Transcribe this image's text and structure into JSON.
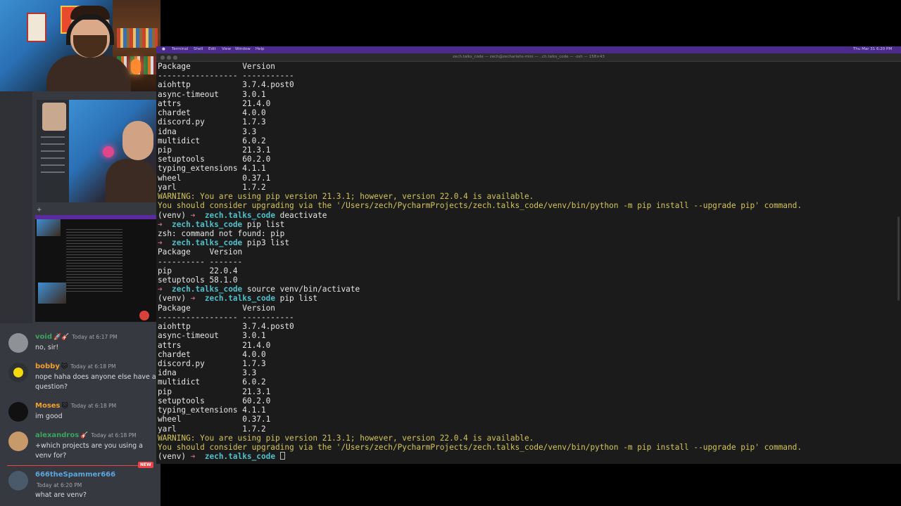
{
  "terminal": {
    "menu": [
      "Terminal",
      "Shell",
      "Edit",
      "View",
      "Window",
      "Help"
    ],
    "window_title": "zech.talks_code — zech@zecharlahs-mini — ..ch.talks_code — -zsh — 158×43",
    "clock": "Thu Mar 31  6:20 PM",
    "prompt_venv": "(venv)",
    "prompt_arrow": "➜",
    "prompt_dir": "zech.talks_code",
    "lines": [
      {
        "kind": "out",
        "text": "Package           Version"
      },
      {
        "kind": "out",
        "text": "----------------- -----------"
      },
      {
        "kind": "out",
        "text": "aiohttp           3.7.4.post0"
      },
      {
        "kind": "out",
        "text": "async-timeout     3.0.1"
      },
      {
        "kind": "out",
        "text": "attrs             21.4.0"
      },
      {
        "kind": "out",
        "text": "chardet           4.0.0"
      },
      {
        "kind": "out",
        "text": "discord.py        1.7.3"
      },
      {
        "kind": "out",
        "text": "idna              3.3"
      },
      {
        "kind": "out",
        "text": "multidict         6.0.2"
      },
      {
        "kind": "out",
        "text": "pip               21.3.1"
      },
      {
        "kind": "out",
        "text": "setuptools        60.2.0"
      },
      {
        "kind": "out",
        "text": "typing_extensions 4.1.1"
      },
      {
        "kind": "out",
        "text": "wheel             0.37.1"
      },
      {
        "kind": "out",
        "text": "yarl              1.7.2"
      },
      {
        "kind": "warn",
        "text": "WARNING: You are using pip version 21.3.1; however, version 22.0.4 is available."
      },
      {
        "kind": "warn",
        "text": "You should consider upgrading via the '/Users/zech/PycharmProjects/zech.talks_code/venv/bin/python -m pip install --upgrade pip' command."
      },
      {
        "kind": "venv",
        "text": " deactivate"
      },
      {
        "kind": "plain",
        "text": " pip list"
      },
      {
        "kind": "out",
        "text": "zsh: command not found: pip"
      },
      {
        "kind": "plain",
        "text": " pip3 list"
      },
      {
        "kind": "out",
        "text": "Package    Version"
      },
      {
        "kind": "out",
        "text": "---------- -------"
      },
      {
        "kind": "out",
        "text": "pip        22.0.4"
      },
      {
        "kind": "out",
        "text": "setuptools 58.1.0"
      },
      {
        "kind": "plain",
        "text": " source venv/bin/activate"
      },
      {
        "kind": "venv",
        "text": " pip list"
      },
      {
        "kind": "out",
        "text": "Package           Version"
      },
      {
        "kind": "out",
        "text": "----------------- -----------"
      },
      {
        "kind": "out",
        "text": "aiohttp           3.7.4.post0"
      },
      {
        "kind": "out",
        "text": "async-timeout     3.0.1"
      },
      {
        "kind": "out",
        "text": "attrs             21.4.0"
      },
      {
        "kind": "out",
        "text": "chardet           4.0.0"
      },
      {
        "kind": "out",
        "text": "discord.py        1.7.3"
      },
      {
        "kind": "out",
        "text": "idna              3.3"
      },
      {
        "kind": "out",
        "text": "multidict         6.0.2"
      },
      {
        "kind": "out",
        "text": "pip               21.3.1"
      },
      {
        "kind": "out",
        "text": "setuptools        60.2.0"
      },
      {
        "kind": "out",
        "text": "typing_extensions 4.1.1"
      },
      {
        "kind": "out",
        "text": "wheel             0.37.1"
      },
      {
        "kind": "out",
        "text": "yarl              1.7.2"
      },
      {
        "kind": "warn",
        "text": "WARNING: You are using pip version 21.3.1; however, version 22.0.4 is available."
      },
      {
        "kind": "warn",
        "text": "You should consider upgrading via the '/Users/zech/PycharmProjects/zech.talks_code/venv/bin/python -m pip install --upgrade pip' command."
      },
      {
        "kind": "venv-cursor",
        "text": " "
      }
    ]
  },
  "chat": {
    "new_badge": "NEW",
    "messages": [
      {
        "name": "void",
        "badge": "🚀🎸",
        "time": "Today at 6:17 PM",
        "text": "no, sir!",
        "name_color": "#3ba55d",
        "avatar_color": "#8e9297"
      },
      {
        "name": "bobby",
        "badge": "🐱",
        "time": "Today at 6:18 PM",
        "text": "nope haha does anyone else have a question?",
        "name_color": "#f0a030",
        "avatar_color": "#f5d90a"
      },
      {
        "name": "Moses",
        "badge": "🐱",
        "time": "Today at 6:18 PM",
        "text": "im good",
        "name_color": "#f0a030",
        "avatar_color": "#111111"
      },
      {
        "name": "alexandros",
        "badge": "🎸",
        "time": "Today at 6:18 PM",
        "text": "+which projects are you using a venv for?",
        "name_color": "#3ba55d",
        "avatar_color": "#c89a6a"
      },
      {
        "name": "666theSpammer666",
        "badge": "",
        "time": "Today at 6:20 PM",
        "text": "what are venv?",
        "name_color": "#5aa7e0",
        "avatar_color": "#4a5a6a"
      }
    ]
  },
  "colors": {
    "terminal_bg": "#1b1b1b",
    "warning": "#d4c45a",
    "prompt_dir": "#4fbfc9",
    "prompt_arrow": "#c86b8a",
    "menubar": "#4a2a8a"
  }
}
